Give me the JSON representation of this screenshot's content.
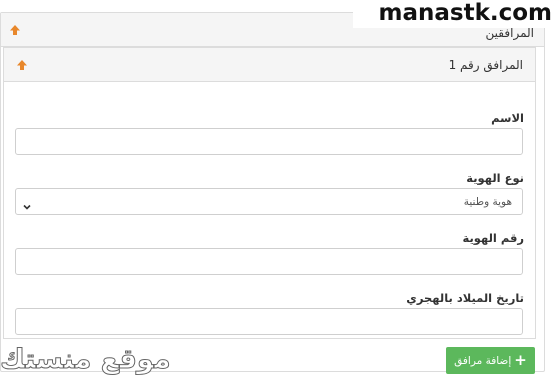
{
  "watermark_top": "manastk.com",
  "watermark_bottom": "موقع منستك",
  "outer_panel": {
    "title": "المرافقين"
  },
  "inner_panel": {
    "title": "المرافق رقم 1"
  },
  "fields": {
    "name_label": "الاسم",
    "name_value": "",
    "id_type_label": "نوع الهوية",
    "id_type_selected": "هوية وطنية",
    "id_number_label": "رقم الهوية",
    "id_number_value": "",
    "birth_date_label": "تاريخ الميلاد بالهجري",
    "birth_date_value": ""
  },
  "add_button": {
    "label": "إضافة مرافق"
  },
  "colors": {
    "accent_arrow": "#e8872b",
    "add_button": "#5cb85c",
    "panel_header": "#f5f5f5",
    "border": "#dcdcdc"
  },
  "icons": {
    "collapse": "arrow-up-icon",
    "dropdown": "chevron-down-icon",
    "add": "plus-icon"
  }
}
